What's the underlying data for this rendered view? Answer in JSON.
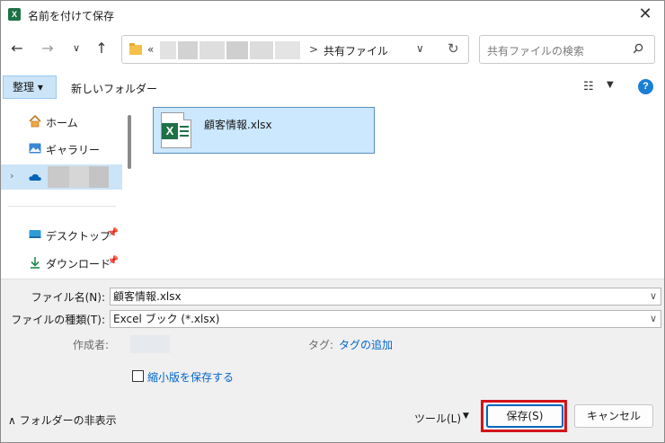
{
  "window": {
    "title": "名前を付けて保存",
    "app_icon_letter": "X"
  },
  "nav": {
    "address_chevron": "«",
    "address_separator": ">",
    "address_current": "共有ファイル",
    "search_placeholder": "共有ファイルの検索"
  },
  "toolbar": {
    "organize_label": "整理 ▾",
    "new_folder_label": "新しいフォルダー"
  },
  "sidebar": {
    "items": [
      {
        "label": "ホーム",
        "icon": "home-icon"
      },
      {
        "label": "ギャラリー",
        "icon": "gallery-icon"
      },
      {
        "label": "",
        "icon": "onedrive-cloud-icon"
      },
      {
        "label": "デスクトップ",
        "icon": "desktop-icon"
      },
      {
        "label": "ダウンロード",
        "icon": "download-icon"
      }
    ]
  },
  "files": [
    {
      "name": "顧客情報.xlsx",
      "icon": "excel-file-icon"
    }
  ],
  "form": {
    "filename_label": "ファイル名(N):",
    "filename_value": "顧客情報.xlsx",
    "filetype_label": "ファイルの種類(T):",
    "filetype_value": "Excel ブック (*.xlsx)",
    "author_label": "作成者:",
    "tag_label": "タグ:",
    "tag_link": "タグの追加",
    "thumbnail_label": "縮小版を保存する"
  },
  "bottom": {
    "hide_folders_label": "フォルダーの非表示",
    "tools_label": "ツール(L)",
    "save_label": "保存(S)",
    "cancel_label": "キャンセル"
  },
  "colors": {
    "accent": "#0067c0",
    "highlight_box": "#d4141b",
    "selection": "#cce8ff",
    "excel_green": "#1e7145"
  }
}
